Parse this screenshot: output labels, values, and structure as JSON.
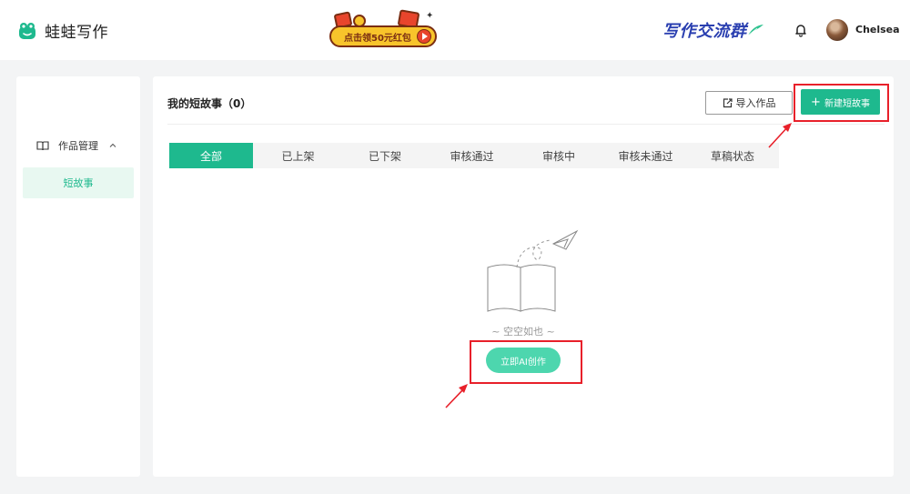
{
  "header": {
    "app_name": "蛙蛙写作",
    "promo_text": "点击领50元红包",
    "group_link": "写作交流群",
    "username": "Chelsea"
  },
  "sidebar": {
    "group_label": "作品管理",
    "items": [
      {
        "label": "短故事",
        "active": true
      }
    ]
  },
  "main": {
    "title": "我的短故事（0）",
    "import_label": "导入作品",
    "new_label": "新建短故事",
    "tabs": [
      {
        "label": "全部",
        "active": true
      },
      {
        "label": "已上架"
      },
      {
        "label": "已下架"
      },
      {
        "label": "审核通过"
      },
      {
        "label": "审核中"
      },
      {
        "label": "审核未通过"
      },
      {
        "label": "草稿状态"
      }
    ],
    "empty_text": "~ 空空如也 ~",
    "ai_button": "立即AI创作"
  },
  "colors": {
    "accent": "#1eb98e",
    "accent_light": "#4dd6ae",
    "annotation": "#e8202a"
  },
  "icons": [
    "frog-logo-icon",
    "bell-icon",
    "book-icon",
    "chevron-up-icon",
    "import-icon",
    "plus-icon",
    "empty-book-illustration"
  ]
}
